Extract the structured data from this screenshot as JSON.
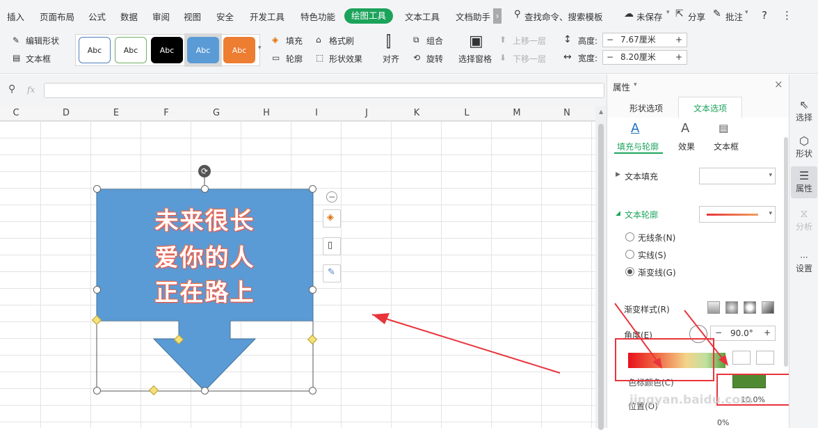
{
  "menubar": {
    "items": [
      "插入",
      "页面布局",
      "公式",
      "数据",
      "审阅",
      "视图",
      "安全",
      "开发工具",
      "特色功能",
      "绘图工具",
      "文本工具",
      "文档助手"
    ],
    "active": "绘图工具",
    "search": "查找命令、搜索模板",
    "unsaved": "未保存",
    "share": "分享",
    "comment": "批注",
    "help": "?",
    "more": "⋮",
    "expand": "›"
  },
  "ribbon": {
    "edit_shape": "编辑形状",
    "text_box": "文本框",
    "style_samples": [
      "Abc",
      "Abc",
      "Abc",
      "Abc",
      "Abc"
    ],
    "fill": "填充",
    "outline": "轮廓",
    "format_painter": "格式刷",
    "shape_effect": "形状效果",
    "align": "对齐",
    "group": "组合",
    "rotate": "旋转",
    "selection_pane": "选择窗格",
    "bring_forward": "上移一层",
    "send_backward": "下移一层",
    "height_label": "高度:",
    "height_value": "7.67厘米",
    "width_label": "宽度:",
    "width_value": "8.20厘米",
    "minus": "−",
    "plus": "+"
  },
  "formula": {
    "fx": "fx"
  },
  "columns": [
    "C",
    "D",
    "E",
    "F",
    "G",
    "H",
    "I",
    "J",
    "K",
    "L",
    "M",
    "N"
  ],
  "shape": {
    "lines": [
      "未来很长",
      "爱你的人",
      "正在路上"
    ],
    "fill_color": "#5b9bd5"
  },
  "panel": {
    "title": "属性",
    "tabs": [
      "形状选项",
      "文本选项"
    ],
    "active_tab": "文本选项",
    "subtabs": [
      "填充与轮廓",
      "效果",
      "文本框"
    ],
    "text_fill": "文本填充",
    "text_outline": "文本轮廓",
    "line_options": [
      "无线条(N)",
      "实线(S)",
      "渐变线(G)"
    ],
    "selected_line": "渐变线(G)",
    "gradient_style": "渐变样式(R)",
    "angle_label": "角度(E)",
    "angle_value": "90.0°",
    "stop_label": "色标颜色(C)",
    "position_label": "位置(O)",
    "position_value": "10.0%",
    "transparency_value": "0%"
  },
  "rail": {
    "items": [
      "选择",
      "形状",
      "属性",
      "分析",
      "设置"
    ]
  },
  "watermark": "jingyan.baidu.com"
}
